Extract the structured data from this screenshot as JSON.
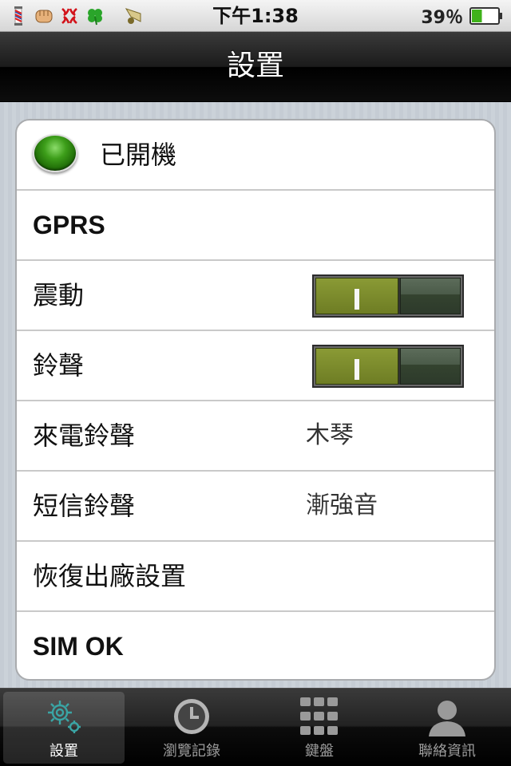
{
  "status_bar": {
    "time": "下午1:38",
    "battery_percent": "39％",
    "battery_level": 0.39,
    "icons": [
      "barber-pole-icon",
      "fist-icon",
      "anger-icon",
      "clover-icon",
      "gramophone-icon"
    ]
  },
  "nav": {
    "title": "設置"
  },
  "settings": {
    "power": {
      "label": "已開機",
      "status": "on",
      "led_color": "#2f8a0f"
    },
    "gprs": {
      "label": "GPRS"
    },
    "vibrate": {
      "label": "震動",
      "state": "on"
    },
    "ringer": {
      "label": "鈴聲",
      "state": "on"
    },
    "incoming_ringtone": {
      "label": "來電鈴聲",
      "value": "木琴"
    },
    "sms_ringtone": {
      "label": "短信鈴聲",
      "value": "漸強音"
    },
    "factory_reset": {
      "label": "恢復出廠設置"
    },
    "sim": {
      "label": "SIM OK"
    }
  },
  "tabs": [
    {
      "label": "設置",
      "icon": "gear-icon",
      "active": true
    },
    {
      "label": "瀏覽記錄",
      "icon": "clock-icon",
      "active": false
    },
    {
      "label": "鍵盤",
      "icon": "keypad-icon",
      "active": false
    },
    {
      "label": "聯絡資訊",
      "icon": "contact-icon",
      "active": false
    }
  ],
  "colors": {
    "toggle_on": "#7a8a2c",
    "toggle_off": "#3d4c3a",
    "nav_bg": "#000000",
    "active_tab_icon": "#2d8f8f"
  }
}
